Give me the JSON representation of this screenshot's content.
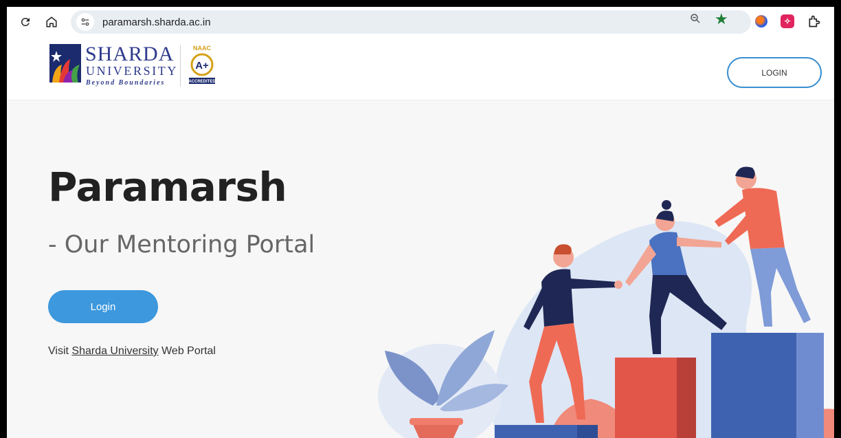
{
  "browser": {
    "url": "paramarsh.sharda.ac.in"
  },
  "header": {
    "logo": {
      "name": "SHARDA",
      "university": "UNIVERSITY",
      "tagline": "Beyond Boundaries",
      "naac_top": "NAAC",
      "naac_grade": "A+",
      "naac_bottom": "ACCREDITED"
    },
    "login_label": "LOGIN"
  },
  "hero": {
    "title": "Paramarsh",
    "subtitle": "- Our Mentoring Portal",
    "login_label": "Login",
    "visit_prefix": "Visit ",
    "visit_link": "Sharda University",
    "visit_suffix": " Web Portal"
  },
  "colors": {
    "accent": "#3d98dd",
    "title": "#222222",
    "subtitle": "#666666",
    "brand": "#2d3a8c"
  }
}
